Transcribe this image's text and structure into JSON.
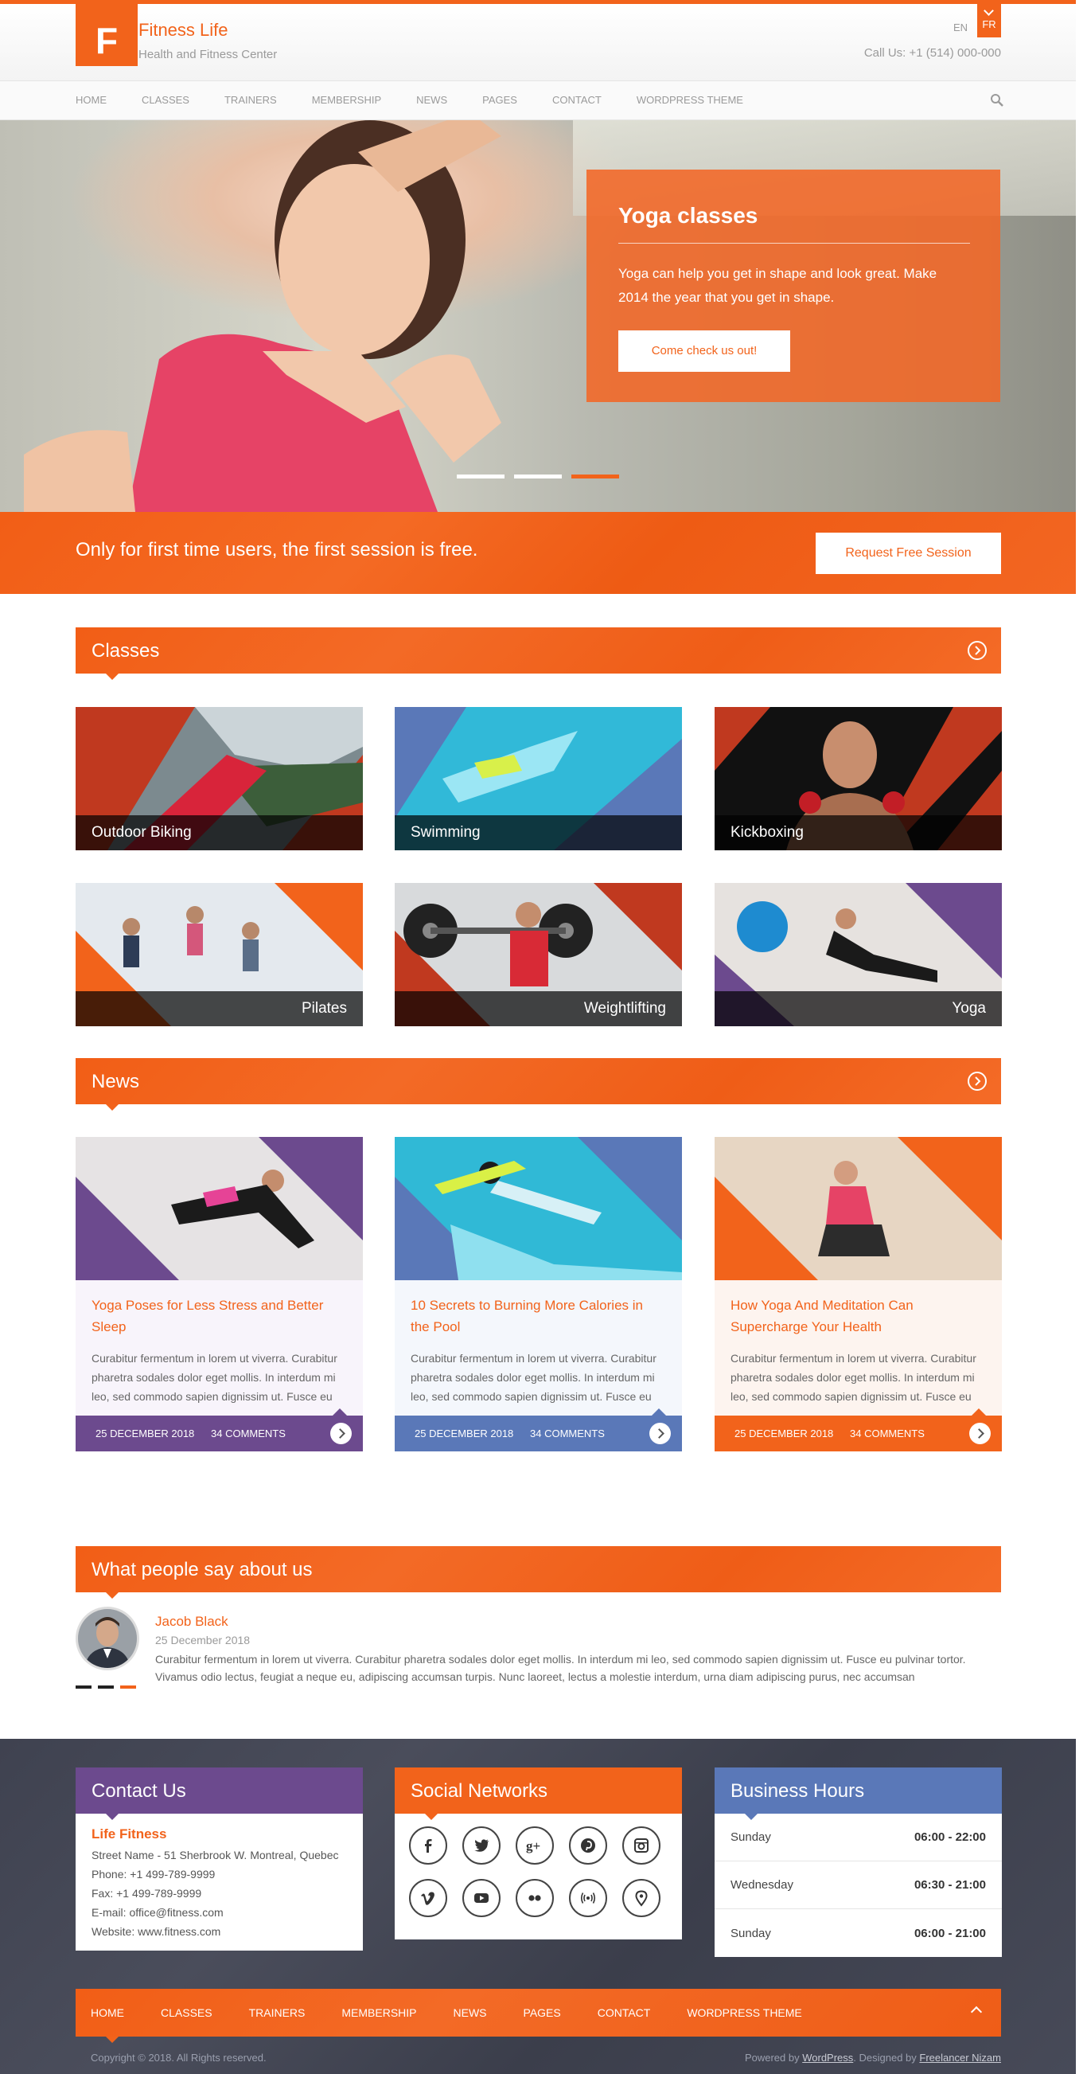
{
  "header": {
    "logo_letter": "F",
    "site_name": "Fitness Life",
    "tagline": "Health and Fitness Center",
    "languages": [
      "EN",
      "FR"
    ],
    "call_us": "Call Us: +1 (514) 000-000"
  },
  "nav": {
    "items": [
      "HOME",
      "CLASSES",
      "TRAINERS",
      "MEMBERSHIP",
      "NEWS",
      "PAGES",
      "CONTACT",
      "WORDPRESS THEME"
    ],
    "search_icon": "search-icon"
  },
  "hero": {
    "title": "Yoga classes",
    "text": "Yoga can help you get in shape and look great. Make 2014 the year that you get in shape.",
    "button": "Come check us out!",
    "slides": 3,
    "active_slide": 3
  },
  "cta": {
    "text": "Only for first time users, the first session is free.",
    "button": "Request Free Session"
  },
  "classes": {
    "title": "Classes",
    "items": [
      {
        "label": "Outdoor Biking"
      },
      {
        "label": "Swimming"
      },
      {
        "label": "Kickboxing"
      },
      {
        "label": "Pilates"
      },
      {
        "label": "Weightlifting"
      },
      {
        "label": "Yoga"
      }
    ]
  },
  "news": {
    "title": "News",
    "items": [
      {
        "title": "Yoga Poses for Less Stress and Better Sleep",
        "text": "Curabitur fermentum in lorem ut viverra. Curabitur pharetra sodales dolor eget mollis. In interdum mi leo, sed commodo sapien dignissim ut. Fusce eu",
        "date": "25 DECEMBER 2018",
        "comments": "34 COMMENTS",
        "accent": "#6c4a8e"
      },
      {
        "title": "10 Secrets to Burning More Calories in the Pool",
        "text": "Curabitur fermentum in lorem ut viverra. Curabitur pharetra sodales dolor eget mollis. In interdum mi leo, sed commodo sapien dignissim ut. Fusce eu",
        "date": "25 DECEMBER 2018",
        "comments": "34 COMMENTS",
        "accent": "#5a78b8"
      },
      {
        "title": "How Yoga And Meditation Can Supercharge Your Health",
        "text": "Curabitur fermentum in lorem ut viverra. Curabitur pharetra sodales dolor eget mollis. In interdum mi leo, sed commodo sapien dignissim ut. Fusce eu",
        "date": "25 DECEMBER 2018",
        "comments": "34 COMMENTS",
        "accent": "#f2631b"
      }
    ]
  },
  "testimonials": {
    "title": "What people say about us",
    "name": "Jacob Black",
    "date": "25 December 2018",
    "text": "Curabitur fermentum in lorem ut viverra. Curabitur pharetra sodales dolor eget mollis. In interdum mi leo, sed commodo sapien dignissim ut. Fusce eu pulvinar tortor. Vivamus odio lectus, feugiat a neque eu, adipiscing accumsan turpis. Nunc laoreet, lectus a molestie interdum, urna diam adipiscing purus, nec accumsan"
  },
  "footer": {
    "contact": {
      "title": "Contact Us",
      "name": "Life Fitness",
      "street": "Street Name - 51 Sherbrook W. Montreal, Quebec",
      "phone": "Phone: +1 499-789-9999",
      "fax": "Fax: +1 499-789-9999",
      "email": "E-mail: office@fitness.com",
      "website": "Website: www.fitness.com"
    },
    "social": {
      "title": "Social Networks",
      "icons": [
        "facebook-icon",
        "twitter-icon",
        "google-plus-icon",
        "pinterest-icon",
        "instagram-icon",
        "vimeo-icon",
        "youtube-icon",
        "flickr-icon",
        "rss-icon",
        "location-pin-icon"
      ]
    },
    "hours": {
      "title": "Business Hours",
      "rows": [
        {
          "day": "Sunday",
          "time": "06:00 - 22:00"
        },
        {
          "day": "Wednesday",
          "time": "06:30 - 21:00"
        },
        {
          "day": "Sunday",
          "time": "06:00 - 21:00"
        }
      ]
    },
    "nav": [
      "HOME",
      "CLASSES",
      "TRAINERS",
      "MEMBERSHIP",
      "NEWS",
      "PAGES",
      "CONTACT",
      "WORDPRESS THEME"
    ],
    "copyright": "Copyright © 2018. All Rights reserved.",
    "powered_prefix": "Powered by",
    "powered_link": "WordPress",
    "designed_prefix": ". Designed by",
    "designed_link": "Freelancer Nizam"
  },
  "colors": {
    "accent": "#f2631b",
    "purple": "#6c4a8e",
    "blue": "#5a78b8",
    "footer_bg": "#43465 4"
  }
}
